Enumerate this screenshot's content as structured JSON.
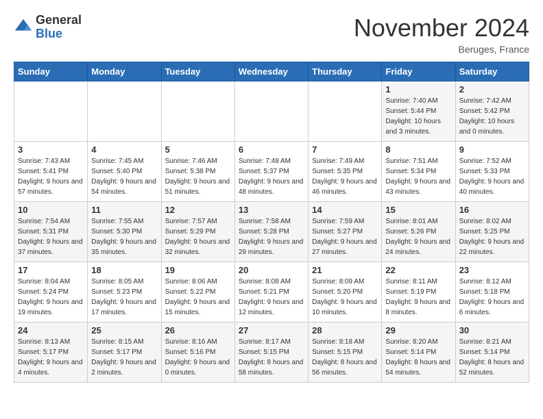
{
  "header": {
    "logo_general": "General",
    "logo_blue": "Blue",
    "month_title": "November 2024",
    "location": "Beruges, France"
  },
  "days_of_week": [
    "Sunday",
    "Monday",
    "Tuesday",
    "Wednesday",
    "Thursday",
    "Friday",
    "Saturday"
  ],
  "weeks": [
    [
      {
        "day": "",
        "sunrise": "",
        "sunset": "",
        "daylight": ""
      },
      {
        "day": "",
        "sunrise": "",
        "sunset": "",
        "daylight": ""
      },
      {
        "day": "",
        "sunrise": "",
        "sunset": "",
        "daylight": ""
      },
      {
        "day": "",
        "sunrise": "",
        "sunset": "",
        "daylight": ""
      },
      {
        "day": "",
        "sunrise": "",
        "sunset": "",
        "daylight": ""
      },
      {
        "day": "1",
        "sunrise": "Sunrise: 7:40 AM",
        "sunset": "Sunset: 5:44 PM",
        "daylight": "Daylight: 10 hours and 3 minutes."
      },
      {
        "day": "2",
        "sunrise": "Sunrise: 7:42 AM",
        "sunset": "Sunset: 5:42 PM",
        "daylight": "Daylight: 10 hours and 0 minutes."
      }
    ],
    [
      {
        "day": "3",
        "sunrise": "Sunrise: 7:43 AM",
        "sunset": "Sunset: 5:41 PM",
        "daylight": "Daylight: 9 hours and 57 minutes."
      },
      {
        "day": "4",
        "sunrise": "Sunrise: 7:45 AM",
        "sunset": "Sunset: 5:40 PM",
        "daylight": "Daylight: 9 hours and 54 minutes."
      },
      {
        "day": "5",
        "sunrise": "Sunrise: 7:46 AM",
        "sunset": "Sunset: 5:38 PM",
        "daylight": "Daylight: 9 hours and 51 minutes."
      },
      {
        "day": "6",
        "sunrise": "Sunrise: 7:48 AM",
        "sunset": "Sunset: 5:37 PM",
        "daylight": "Daylight: 9 hours and 48 minutes."
      },
      {
        "day": "7",
        "sunrise": "Sunrise: 7:49 AM",
        "sunset": "Sunset: 5:35 PM",
        "daylight": "Daylight: 9 hours and 46 minutes."
      },
      {
        "day": "8",
        "sunrise": "Sunrise: 7:51 AM",
        "sunset": "Sunset: 5:34 PM",
        "daylight": "Daylight: 9 hours and 43 minutes."
      },
      {
        "day": "9",
        "sunrise": "Sunrise: 7:52 AM",
        "sunset": "Sunset: 5:33 PM",
        "daylight": "Daylight: 9 hours and 40 minutes."
      }
    ],
    [
      {
        "day": "10",
        "sunrise": "Sunrise: 7:54 AM",
        "sunset": "Sunset: 5:31 PM",
        "daylight": "Daylight: 9 hours and 37 minutes."
      },
      {
        "day": "11",
        "sunrise": "Sunrise: 7:55 AM",
        "sunset": "Sunset: 5:30 PM",
        "daylight": "Daylight: 9 hours and 35 minutes."
      },
      {
        "day": "12",
        "sunrise": "Sunrise: 7:57 AM",
        "sunset": "Sunset: 5:29 PM",
        "daylight": "Daylight: 9 hours and 32 minutes."
      },
      {
        "day": "13",
        "sunrise": "Sunrise: 7:58 AM",
        "sunset": "Sunset: 5:28 PM",
        "daylight": "Daylight: 9 hours and 29 minutes."
      },
      {
        "day": "14",
        "sunrise": "Sunrise: 7:59 AM",
        "sunset": "Sunset: 5:27 PM",
        "daylight": "Daylight: 9 hours and 27 minutes."
      },
      {
        "day": "15",
        "sunrise": "Sunrise: 8:01 AM",
        "sunset": "Sunset: 5:26 PM",
        "daylight": "Daylight: 9 hours and 24 minutes."
      },
      {
        "day": "16",
        "sunrise": "Sunrise: 8:02 AM",
        "sunset": "Sunset: 5:25 PM",
        "daylight": "Daylight: 9 hours and 22 minutes."
      }
    ],
    [
      {
        "day": "17",
        "sunrise": "Sunrise: 8:04 AM",
        "sunset": "Sunset: 5:24 PM",
        "daylight": "Daylight: 9 hours and 19 minutes."
      },
      {
        "day": "18",
        "sunrise": "Sunrise: 8:05 AM",
        "sunset": "Sunset: 5:23 PM",
        "daylight": "Daylight: 9 hours and 17 minutes."
      },
      {
        "day": "19",
        "sunrise": "Sunrise: 8:06 AM",
        "sunset": "Sunset: 5:22 PM",
        "daylight": "Daylight: 9 hours and 15 minutes."
      },
      {
        "day": "20",
        "sunrise": "Sunrise: 8:08 AM",
        "sunset": "Sunset: 5:21 PM",
        "daylight": "Daylight: 9 hours and 12 minutes."
      },
      {
        "day": "21",
        "sunrise": "Sunrise: 8:09 AM",
        "sunset": "Sunset: 5:20 PM",
        "daylight": "Daylight: 9 hours and 10 minutes."
      },
      {
        "day": "22",
        "sunrise": "Sunrise: 8:11 AM",
        "sunset": "Sunset: 5:19 PM",
        "daylight": "Daylight: 9 hours and 8 minutes."
      },
      {
        "day": "23",
        "sunrise": "Sunrise: 8:12 AM",
        "sunset": "Sunset: 5:18 PM",
        "daylight": "Daylight: 9 hours and 6 minutes."
      }
    ],
    [
      {
        "day": "24",
        "sunrise": "Sunrise: 8:13 AM",
        "sunset": "Sunset: 5:17 PM",
        "daylight": "Daylight: 9 hours and 4 minutes."
      },
      {
        "day": "25",
        "sunrise": "Sunrise: 8:15 AM",
        "sunset": "Sunset: 5:17 PM",
        "daylight": "Daylight: 9 hours and 2 minutes."
      },
      {
        "day": "26",
        "sunrise": "Sunrise: 8:16 AM",
        "sunset": "Sunset: 5:16 PM",
        "daylight": "Daylight: 9 hours and 0 minutes."
      },
      {
        "day": "27",
        "sunrise": "Sunrise: 8:17 AM",
        "sunset": "Sunset: 5:15 PM",
        "daylight": "Daylight: 8 hours and 58 minutes."
      },
      {
        "day": "28",
        "sunrise": "Sunrise: 8:18 AM",
        "sunset": "Sunset: 5:15 PM",
        "daylight": "Daylight: 8 hours and 56 minutes."
      },
      {
        "day": "29",
        "sunrise": "Sunrise: 8:20 AM",
        "sunset": "Sunset: 5:14 PM",
        "daylight": "Daylight: 8 hours and 54 minutes."
      },
      {
        "day": "30",
        "sunrise": "Sunrise: 8:21 AM",
        "sunset": "Sunset: 5:14 PM",
        "daylight": "Daylight: 8 hours and 52 minutes."
      }
    ]
  ]
}
